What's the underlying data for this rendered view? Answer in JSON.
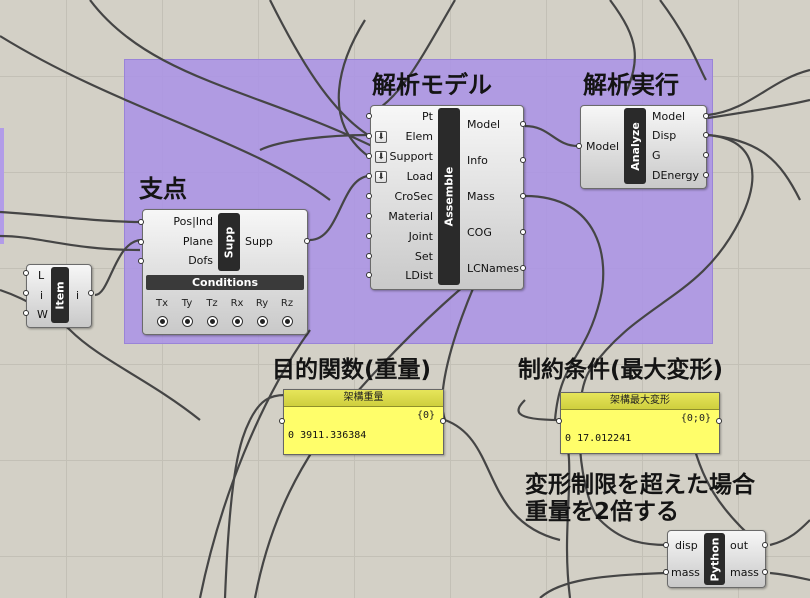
{
  "groups": {
    "support_title": "支点",
    "model_title": "解析モデル",
    "analyze_title": "解析実行",
    "objective_title": "目的関数(重量)",
    "constraint_title": "制約条件(最大変形)",
    "note_line1": "変形制限を超えた場合",
    "note_line2": "重量を2倍する"
  },
  "item": {
    "nickname": "Item",
    "inputs": [
      "L",
      "i",
      "W"
    ],
    "output": "i"
  },
  "support": {
    "nickname": "Supp",
    "inputs": [
      "Pos|Ind",
      "Plane",
      "Dofs"
    ],
    "output": "Supp",
    "conditions_label": "Conditions",
    "dofs": [
      "Tx",
      "Ty",
      "Tz",
      "Rx",
      "Ry",
      "Rz"
    ]
  },
  "assemble": {
    "nickname": "Assemble",
    "inputs": [
      "Pt",
      "Elem",
      "Support",
      "Load",
      "CroSec",
      "Material",
      "Joint",
      "Set",
      "LDist"
    ],
    "outputs": [
      "Model",
      "Info",
      "Mass",
      "COG",
      "LCNames"
    ]
  },
  "analyze": {
    "nickname": "Analyze",
    "input": "Model",
    "outputs": [
      "Model",
      "Disp",
      "G",
      "DEnergy"
    ]
  },
  "mass_panel": {
    "header": "架構重量",
    "path": "{0}",
    "index": "0",
    "value": "3911.336384"
  },
  "disp_panel": {
    "header": "架構最大変形",
    "path": "{0;0}",
    "index": "0",
    "value": "17.012241"
  },
  "python": {
    "nickname": "Python",
    "inputs": [
      "disp",
      "mass"
    ],
    "outputs": [
      "out",
      "mass"
    ]
  },
  "colors": {
    "canvas": "#d3d0c6",
    "group": "#ad96e4",
    "panel": "#fffe6a",
    "wire": "#4a4a4a"
  }
}
